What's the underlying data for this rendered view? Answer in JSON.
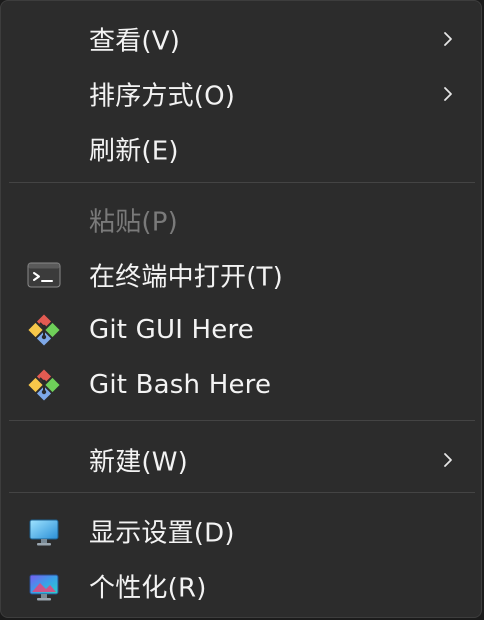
{
  "menu": {
    "items": [
      {
        "label": "查看(V)",
        "has_submenu": true
      },
      {
        "label": "排序方式(O)",
        "has_submenu": true
      },
      {
        "label": "刷新(E)",
        "has_submenu": false
      },
      {
        "label": "粘贴(P)",
        "disabled": true
      },
      {
        "label": "在终端中打开(T)",
        "icon": "terminal-icon"
      },
      {
        "label": "Git GUI Here",
        "icon": "git-icon"
      },
      {
        "label": "Git Bash Here",
        "icon": "git-icon"
      },
      {
        "label": "新建(W)",
        "has_submenu": true
      },
      {
        "label": "显示设置(D)",
        "icon": "display-settings-icon"
      },
      {
        "label": "个性化(R)",
        "icon": "personalize-icon"
      }
    ]
  },
  "colors": {
    "menu_bg": "#2c2c2c",
    "text": "#f3f3f3",
    "disabled_text": "#7a7a7a",
    "separator": "#444444"
  }
}
